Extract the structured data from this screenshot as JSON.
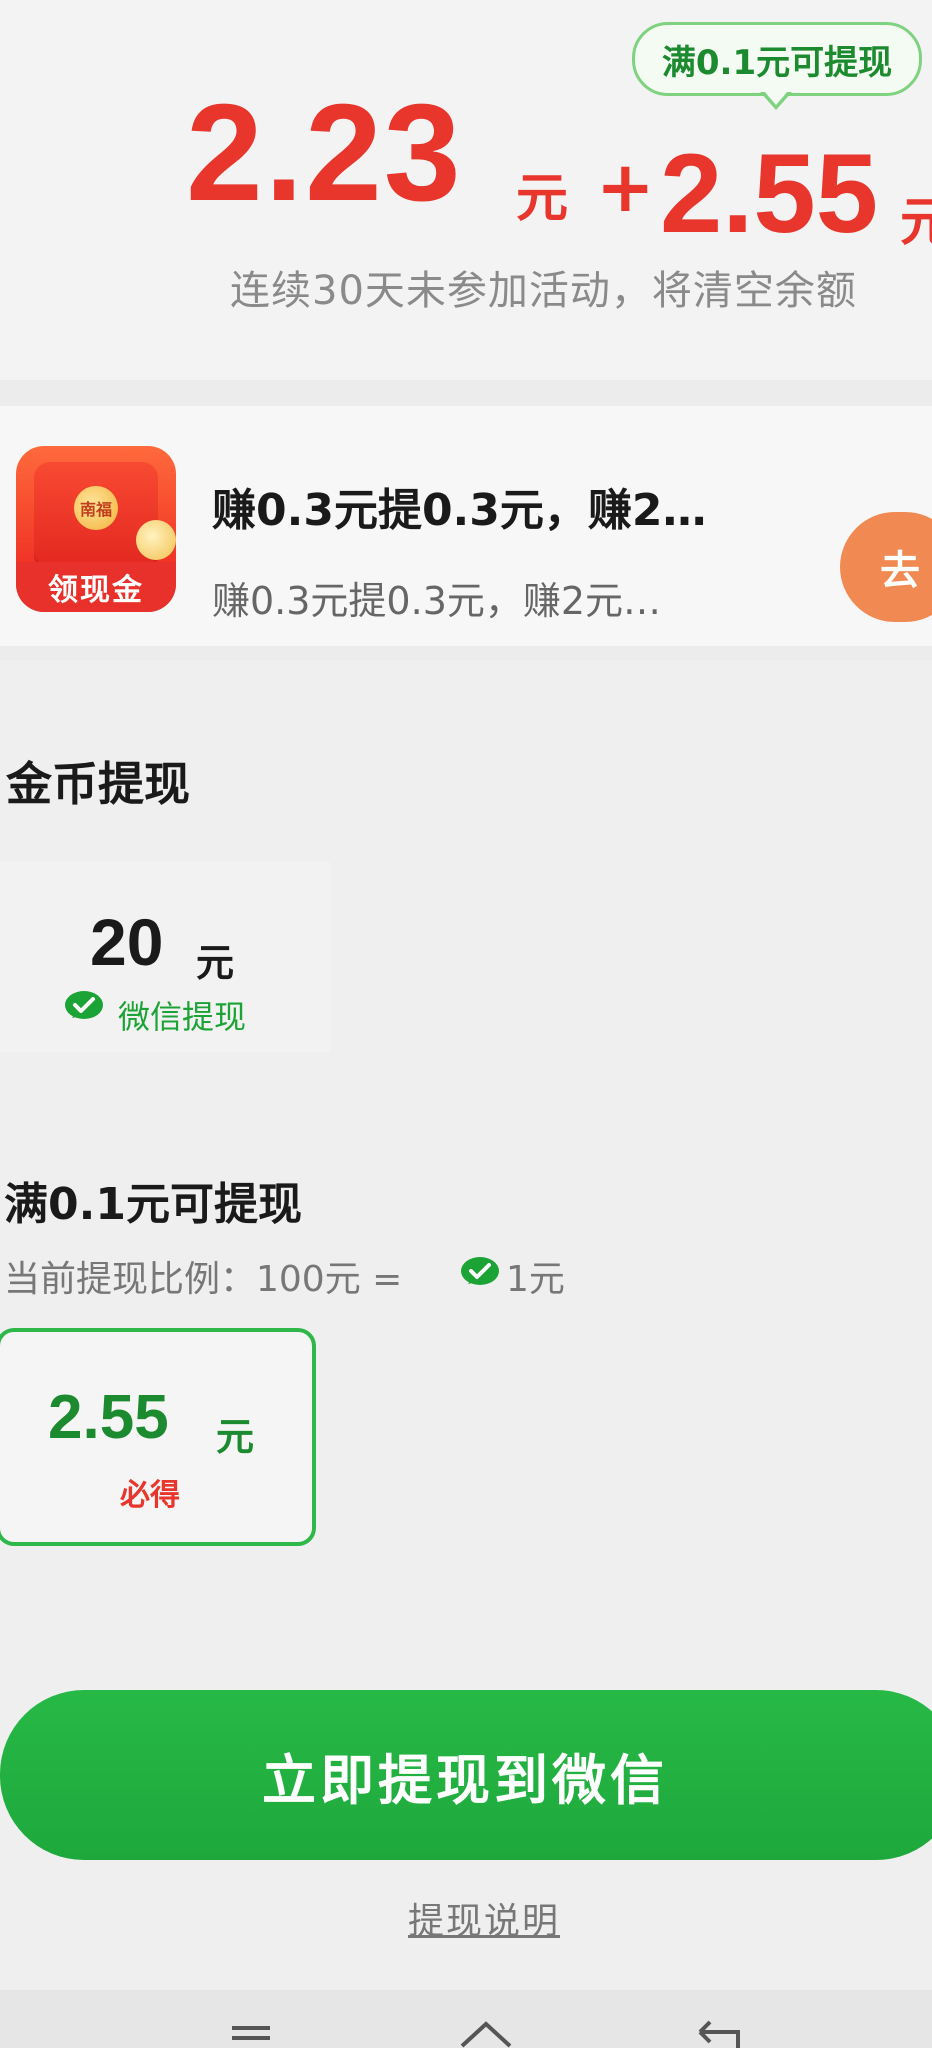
{
  "header": {
    "tip_bubble": "满0.1元可提现",
    "amount_primary": "2.23",
    "unit_primary": "元",
    "plus_sign": "+",
    "amount_secondary": "2.55",
    "unit_secondary": "元",
    "warning": "连续30天未参加活动，将清空余额"
  },
  "ad": {
    "icon_name": "red-envelope-cash-icon",
    "icon_badge": "南福",
    "icon_label": "领现金",
    "title": "赚0.3元提0.3元，赚2…",
    "subtitle": "赚0.3元提0.3元，赚2元…",
    "button_label": "去"
  },
  "coin_withdraw": {
    "title": "金币提现",
    "option": {
      "amount": "20",
      "unit": "元",
      "channel_icon": "wechat-icon",
      "channel_label": "微信提现"
    }
  },
  "min_withdraw": {
    "title": "满0.1元可提现",
    "ratio_label": "当前提现比例：100元 =",
    "ratio_icon": "wechat-icon",
    "ratio_value": "1元",
    "selected_option": {
      "amount": "2.55",
      "unit": "元",
      "tag": "必得"
    }
  },
  "actions": {
    "withdraw_button": "立即提现到微信",
    "help_link": "提现说明"
  },
  "system_nav": {
    "menu_icon": "menu-icon",
    "home_icon": "home-icon",
    "back_icon": "back-icon"
  },
  "colors": {
    "amount_red": "#e8362d",
    "wechat_green": "#1ca336",
    "button_green": "#22b040",
    "ad_orange": "#f08a52"
  }
}
